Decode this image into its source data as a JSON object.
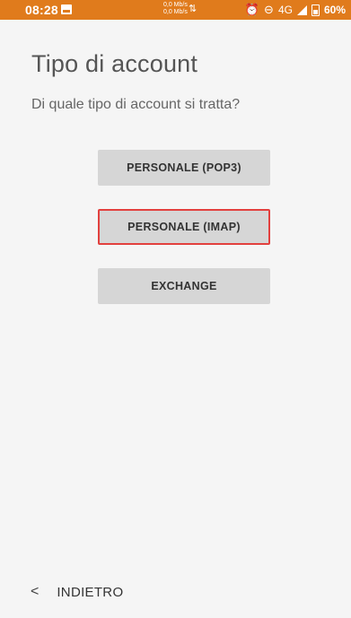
{
  "status_bar": {
    "time": "08:28",
    "net_speed_up": "0,0 Mb/s",
    "net_speed_down": "0,0 Mb/s",
    "network": "4G",
    "battery": "60%",
    "background_color": "#e07b1c"
  },
  "screen": {
    "title": "Tipo di account",
    "subtitle": "Di quale tipo di account si tratta?"
  },
  "account_types": {
    "pop3_label": "PERSONALE (POP3)",
    "imap_label": "PERSONALE (IMAP)",
    "exchange_label": "EXCHANGE",
    "highlight_color": "#e2403e"
  },
  "nav": {
    "back_chevron": "<",
    "back_label": "INDIETRO"
  }
}
